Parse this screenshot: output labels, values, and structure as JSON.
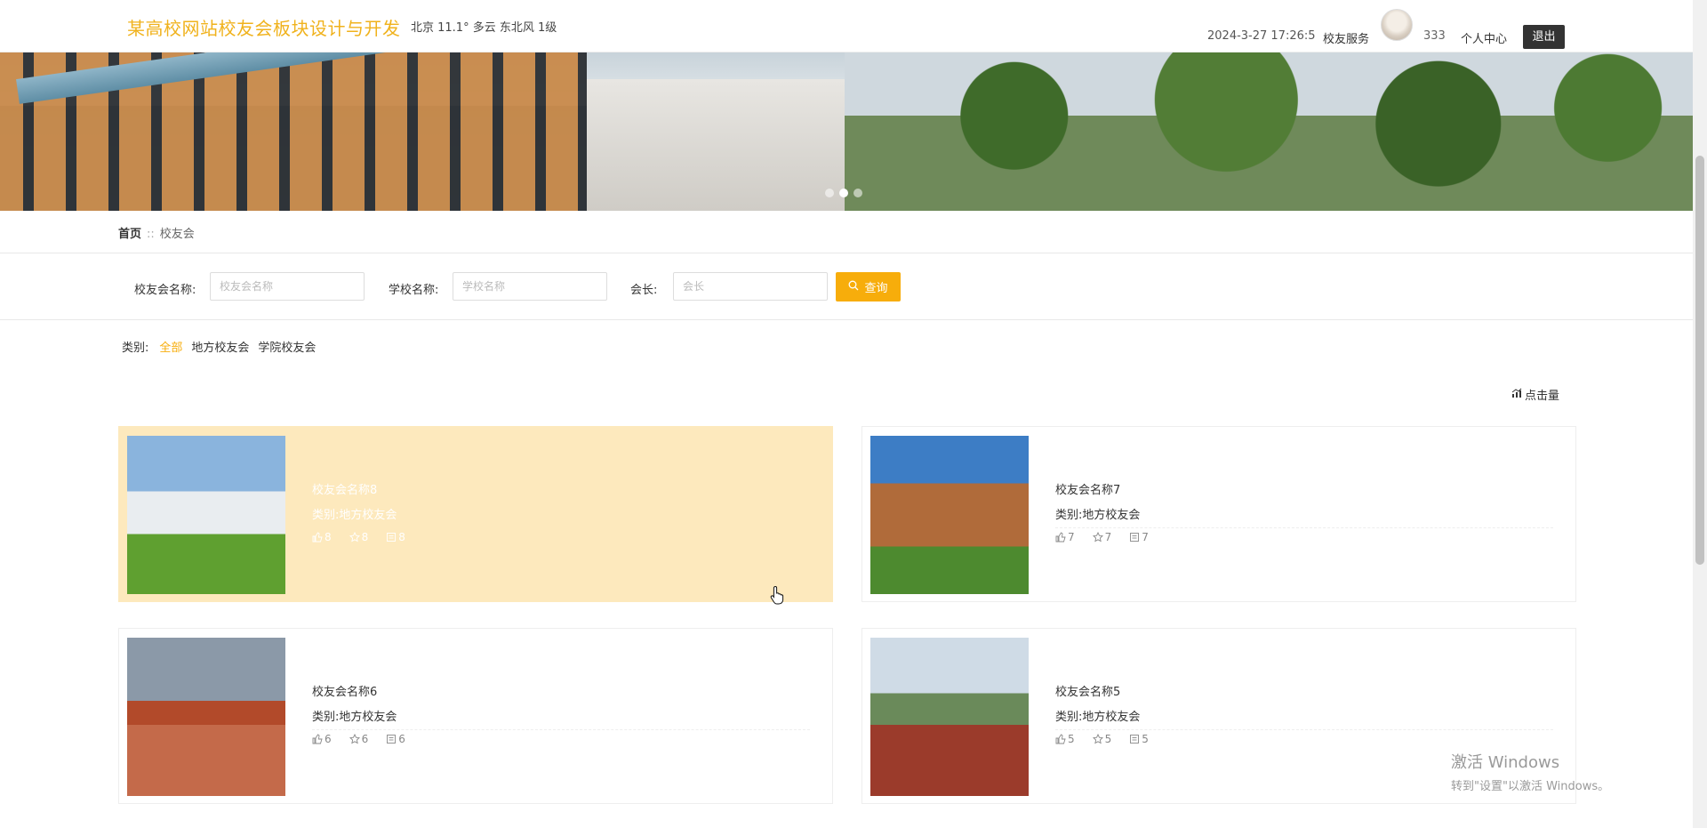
{
  "header": {
    "site_title": "某高校网站校友会板块设计与开发",
    "weather": "北京  11.1°  多云  东北风  1级",
    "datetime": "2024-3-27 17:26:5",
    "service_link": "校友服务",
    "username": "333",
    "user_center": "个人中心",
    "logout": "退出"
  },
  "breadcrumb": {
    "home": "首页",
    "current": "校友会"
  },
  "search": {
    "name_label": "校友会名称:",
    "name_placeholder": "校友会名称",
    "school_label": "学校名称:",
    "school_placeholder": "学校名称",
    "president_label": "会长:",
    "president_placeholder": "会长",
    "button_label": "查询"
  },
  "category": {
    "label": "类别:",
    "items": [
      "全部",
      "地方校友会",
      "学院校友会"
    ]
  },
  "sort": {
    "label": "点击量"
  },
  "cards": [
    {
      "name": "校友会名称8",
      "type": "类别:地方校友会",
      "likes": "8",
      "favorites": "8",
      "comments": "8"
    },
    {
      "name": "校友会名称7",
      "type": "类别:地方校友会",
      "likes": "7",
      "favorites": "7",
      "comments": "7"
    },
    {
      "name": "校友会名称6",
      "type": "类别:地方校友会",
      "likes": "6",
      "favorites": "6",
      "comments": "6"
    },
    {
      "name": "校友会名称5",
      "type": "类别:地方校友会",
      "likes": "5",
      "favorites": "5",
      "comments": "5"
    }
  ],
  "watermark": {
    "line1": "激活 Windows",
    "line2": "转到\"设置\"以激活 Windows。"
  }
}
